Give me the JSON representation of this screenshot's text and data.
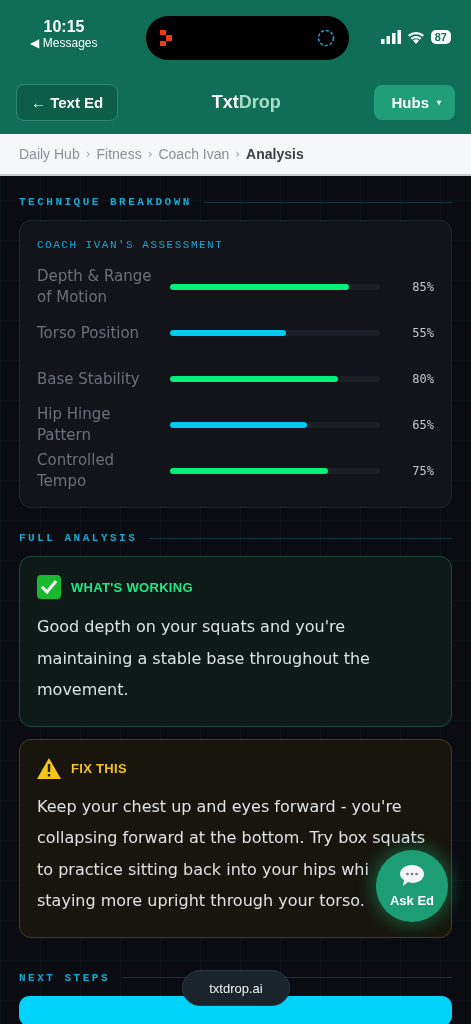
{
  "status_bar": {
    "time": "10:15",
    "back_glyph": "◀",
    "back_label": "Messages",
    "battery": "87"
  },
  "header": {
    "back_button": "← Text Ed",
    "logo": {
      "first": "Txt",
      "second": "Drop"
    },
    "menu_button": "Hubs",
    "menu_caret": "▾"
  },
  "breadcrumb": [
    {
      "label": "Daily Hub",
      "current": false
    },
    {
      "label": "Fitness",
      "current": false
    },
    {
      "label": "Coach Ivan",
      "current": false
    },
    {
      "label": "Analysis",
      "current": true
    }
  ],
  "breadcrumb_separator": "›",
  "technique": {
    "heading": "TECHNIQUE BREAKDOWN",
    "card_title": "COACH IVAN'S ASSESSMENT",
    "metrics": [
      {
        "name": "Depth & Range of Motion",
        "level": 0.85,
        "reading": "85%",
        "color": "#00f07a"
      },
      {
        "name": "Torso Position",
        "level": 0.55,
        "reading": "55%",
        "color": "#00c8f0"
      },
      {
        "name": "Base Stability",
        "level": 0.8,
        "reading": "80%",
        "color": "#00f07a"
      },
      {
        "name": "Hip Hinge Pattern",
        "level": 0.65,
        "reading": "65%",
        "color": "#00c8f0"
      },
      {
        "name": "Controlled Tempo",
        "level": 0.75,
        "reading": "75%",
        "color": "#00f07a"
      }
    ]
  },
  "analysis": {
    "heading": "FULL ANALYSIS",
    "cards": [
      {
        "kind": "good",
        "title": "WHAT'S WORKING",
        "text": "Good depth on your squats and you're maintaining a stable base throughout the movement."
      },
      {
        "kind": "warn",
        "title": "FIX THIS",
        "lines": [
          "Keep your chest up and eyes forward - you're",
          "collapsing forward at the bottom. Try box squats",
          "to practice sitting back into your hips whi",
          "staying more upright through your torso."
        ]
      }
    ]
  },
  "next_steps": {
    "heading": "NEXT STEPS"
  },
  "ask_button": "Ask Ed",
  "url_pill": "txtdrop.ai"
}
